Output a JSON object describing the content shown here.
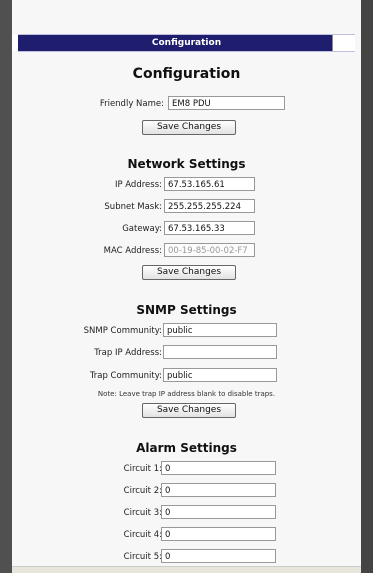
{
  "header": {
    "bar_title": "Configuration"
  },
  "config": {
    "title": "Configuration",
    "friendly_name_label": "Friendly Name:",
    "friendly_name_value": "EM8 PDU",
    "save_label": "Save Changes"
  },
  "network": {
    "title": "Network Settings",
    "ip_label": "IP Address:",
    "ip_value": "67.53.165.61",
    "subnet_label": "Subnet Mask:",
    "subnet_value": "255.255.255.224",
    "gateway_label": "Gateway:",
    "gateway_value": "67.53.165.33",
    "mac_label": "MAC Address:",
    "mac_value": "00-19-85-00-02-F7",
    "save_label": "Save Changes"
  },
  "snmp": {
    "title": "SNMP Settings",
    "community_label": "SNMP Community:",
    "community_value": "public",
    "trap_ip_label": "Trap IP Address:",
    "trap_ip_value": "",
    "trap_community_label": "Trap Community:",
    "trap_community_value": "public",
    "note": "Note: Leave trap IP address blank to disable traps.",
    "save_label": "Save Changes"
  },
  "alarm": {
    "title": "Alarm Settings",
    "circuits": [
      {
        "label": "Circuit 1:",
        "value": "0"
      },
      {
        "label": "Circuit 2:",
        "value": "0"
      },
      {
        "label": "Circuit 3:",
        "value": "0"
      },
      {
        "label": "Circuit 4:",
        "value": "0"
      },
      {
        "label": "Circuit 5:",
        "value": "0"
      }
    ]
  }
}
